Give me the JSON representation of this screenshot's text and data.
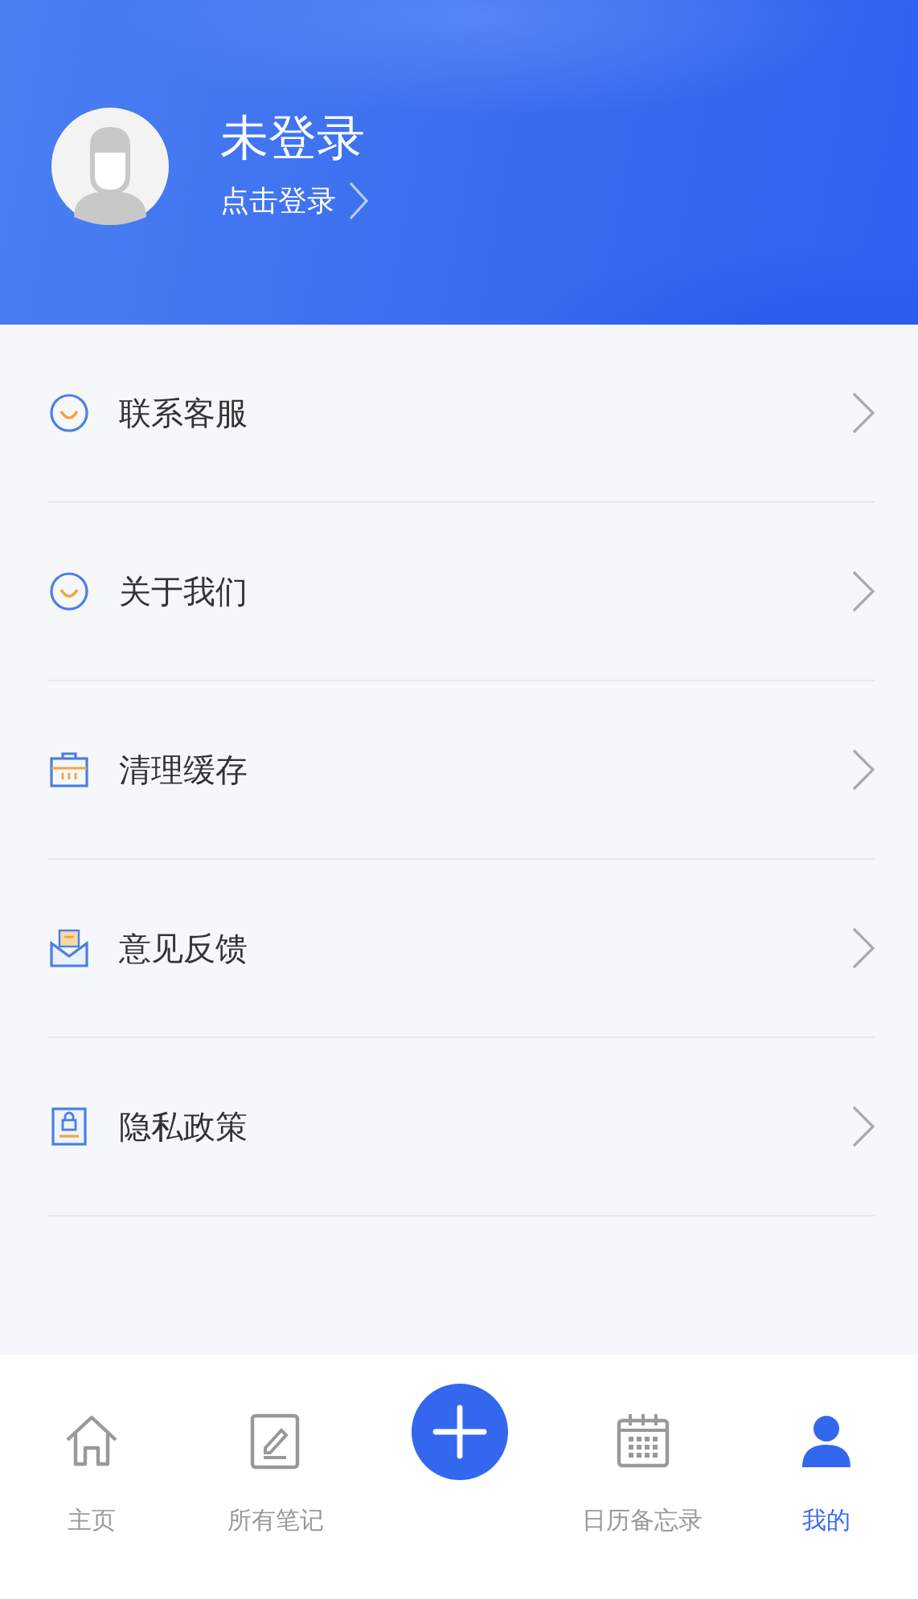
{
  "profile": {
    "name": "未登录",
    "login_link": "点击登录"
  },
  "menu": [
    {
      "kind": "smile",
      "label": "联系客服"
    },
    {
      "kind": "smile",
      "label": "关于我们"
    },
    {
      "kind": "bag",
      "label": "清理缓存"
    },
    {
      "kind": "mail",
      "label": "意见反馈"
    },
    {
      "kind": "lock",
      "label": "隐私政策"
    }
  ],
  "tabs": [
    {
      "kind": "home",
      "label": "主页",
      "selected": false
    },
    {
      "kind": "notes",
      "label": "所有笔记",
      "selected": false
    },
    {
      "kind": "add",
      "selected": false
    },
    {
      "kind": "calendar",
      "label": "日历备忘录",
      "selected": false
    },
    {
      "kind": "user",
      "label": "我的",
      "selected": true
    }
  ]
}
